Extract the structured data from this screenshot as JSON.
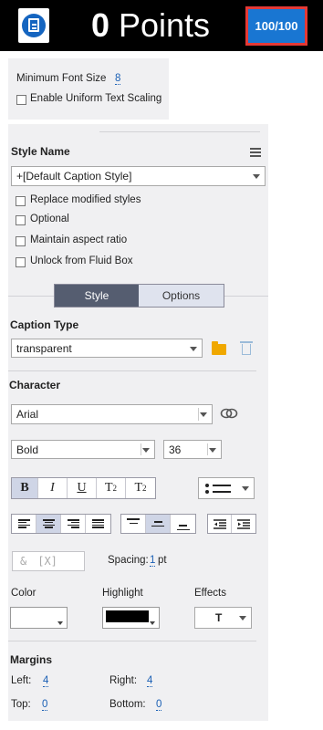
{
  "header": {
    "points_number": "0",
    "points_label": "Points",
    "score": "100/100",
    "bar_color": "#000000",
    "score_bg": "#1976d2",
    "score_border": "#e53935",
    "app_icon": "document-icon"
  },
  "font_panel": {
    "min_font_size_label": "Minimum Font Size",
    "min_font_size_value": "8",
    "uniform_scaling_label": "Enable Uniform Text Scaling"
  },
  "style": {
    "heading": "Style Name",
    "menu_icon": "list-menu-icon",
    "selected": "+[Default Caption Style]",
    "checkboxes": [
      "Replace modified styles",
      "Optional",
      "Maintain aspect ratio",
      "Unlock from Fluid Box"
    ]
  },
  "tabs": {
    "style": "Style",
    "options": "Options",
    "active": "Style"
  },
  "caption": {
    "heading": "Caption Type",
    "selected": "transparent",
    "folder_icon": "folder-icon",
    "delete_icon": "trash-icon"
  },
  "character": {
    "heading": "Character",
    "font_family": "Arial",
    "link_icon": "link-icon",
    "font_style": "Bold",
    "font_size": "36",
    "format_buttons": [
      "B",
      "I",
      "U",
      "T",
      "2",
      "T",
      "2"
    ],
    "bold_label": "B",
    "italic_label": "I",
    "underline_label": "U",
    "superscript_base": "T",
    "superscript_mark": "2",
    "subscript_base": "T",
    "subscript_mark": "2",
    "list_icon": "bullet-list-icon",
    "link_symbols": "&",
    "variable_symbol": "[X]",
    "spacing_label": "Spacing:",
    "spacing_value": "1",
    "spacing_unit": "pt",
    "color_label": "Color",
    "highlight_label": "Highlight",
    "effects_label": "Effects",
    "effects_value": "T",
    "color_value": "#ffffff",
    "highlight_value": "#000000"
  },
  "margins": {
    "heading": "Margins",
    "left_label": "Left:",
    "left_value": "4",
    "right_label": "Right:",
    "right_value": "4",
    "top_label": "Top:",
    "top_value": "0",
    "bottom_label": "Bottom:",
    "bottom_value": "0"
  }
}
